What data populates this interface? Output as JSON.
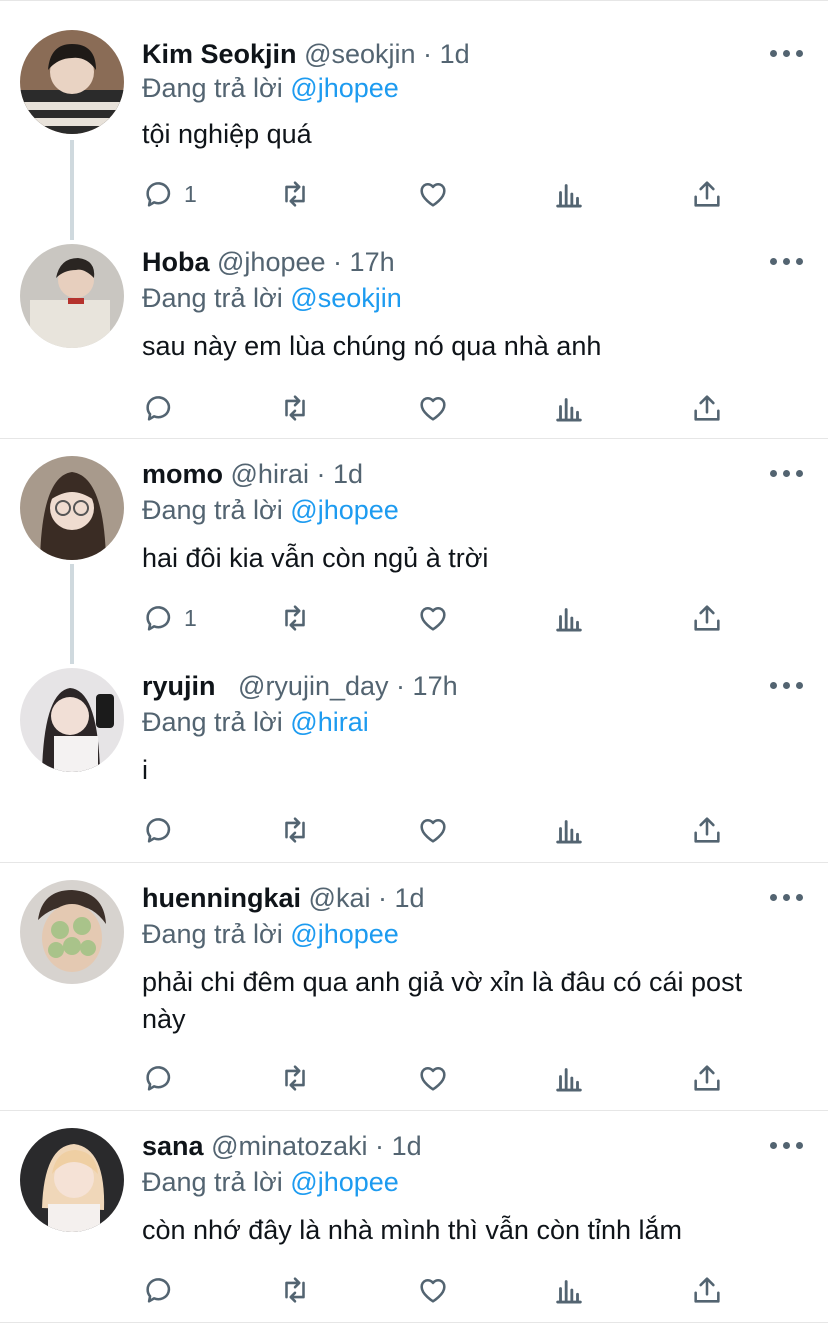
{
  "reply_prefix": "Đang trả lời",
  "colors": {
    "accent": "#1d9bf0",
    "muted": "#536471",
    "text": "#0f1419",
    "line": "#cfd9de"
  },
  "icons": [
    "more-icon",
    "reply-icon",
    "retweet-icon",
    "like-icon",
    "stats-icon",
    "share-icon"
  ],
  "tweets": [
    {
      "name": "Kim Seokjin",
      "handle": "@seokjin",
      "dot": "·",
      "time": "1d",
      "reply_prefix": "Đang trả lời",
      "reply_to": "@jhopee",
      "text": "tội nghiệp quá",
      "reply_count": "1"
    },
    {
      "name": "Hoba",
      "handle": "@jhopee",
      "dot": "·",
      "time": "17h",
      "reply_prefix": "Đang trả lời",
      "reply_to": "@seokjin",
      "text": "sau này em lùa chúng nó qua nhà anh",
      "reply_count": ""
    },
    {
      "name": "momo",
      "handle": "@hirai",
      "dot": "·",
      "time": "1d",
      "reply_prefix": "Đang trả lời",
      "reply_to": "@jhopee",
      "text": "hai đôi kia vẫn còn ngủ à trời",
      "reply_count": "1"
    },
    {
      "name": "ryujin",
      "handle": "@ryujin_day",
      "dot": "·",
      "time": "17h",
      "reply_prefix": "Đang trả lời",
      "reply_to": "@hirai",
      "text": "i",
      "reply_count": ""
    },
    {
      "name": "huenningkai",
      "handle": "@kai",
      "dot": "·",
      "time": "1d",
      "reply_prefix": "Đang trả lời",
      "reply_to": "@jhopee",
      "text": "phải chi đêm qua anh giả vờ xỉn là đâu có cái post này",
      "reply_count": ""
    },
    {
      "name": "sana",
      "handle": "@minatozaki",
      "dot": "·",
      "time": "1d",
      "reply_prefix": "Đang trả lời",
      "reply_to": "@jhopee",
      "text": "còn nhớ đây là nhà mình thì vẫn còn tỉnh lắm",
      "reply_count": ""
    }
  ]
}
